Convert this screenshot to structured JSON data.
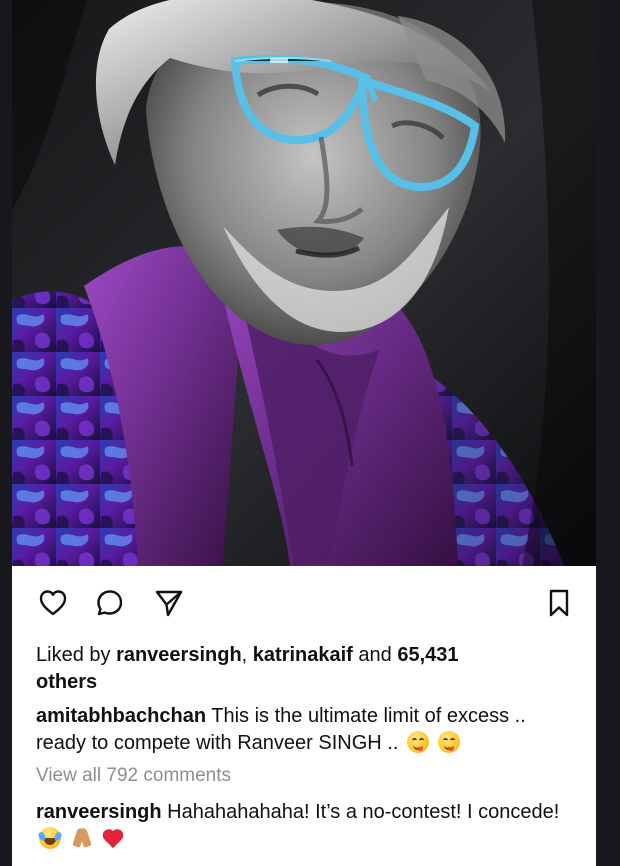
{
  "post": {
    "likes": {
      "prefix": "Liked by ",
      "user_one": "ranveersingh",
      "separator": ", ",
      "user_two": "katrinakaif",
      "middle": " and ",
      "count": "65,431",
      "suffix": "others"
    },
    "caption": {
      "username": "amitabhbachchan",
      "text": "This is the ultimate limit of excess .. ready to compete with Ranveer SINGH .."
    },
    "view_comments": "View all 792 comments",
    "comment": {
      "username": "ranveersingh",
      "text": "Hahahahahaha! It’s a no-contest! I concede!"
    }
  },
  "icons": {
    "like": "heart-outline-icon",
    "comment": "comment-outline-icon",
    "share": "paper-plane-icon",
    "save": "bookmark-outline-icon",
    "caption_emojis": [
      "smiling-tongue-emoji",
      "smiling-tongue-emoji"
    ],
    "comment_emojis": [
      "tears-of-joy-emoji",
      "folded-hands-emoji",
      "red-heart-emoji"
    ]
  },
  "colors": {
    "screen_background": "#1f2126",
    "card_background": "#ffffff",
    "text": "#111111",
    "muted_text": "#8e8e8e",
    "shirt_purple": "#6f2f8f",
    "glasses_blue": "#58bfe6",
    "jacket_blue": "#2b3db2"
  }
}
